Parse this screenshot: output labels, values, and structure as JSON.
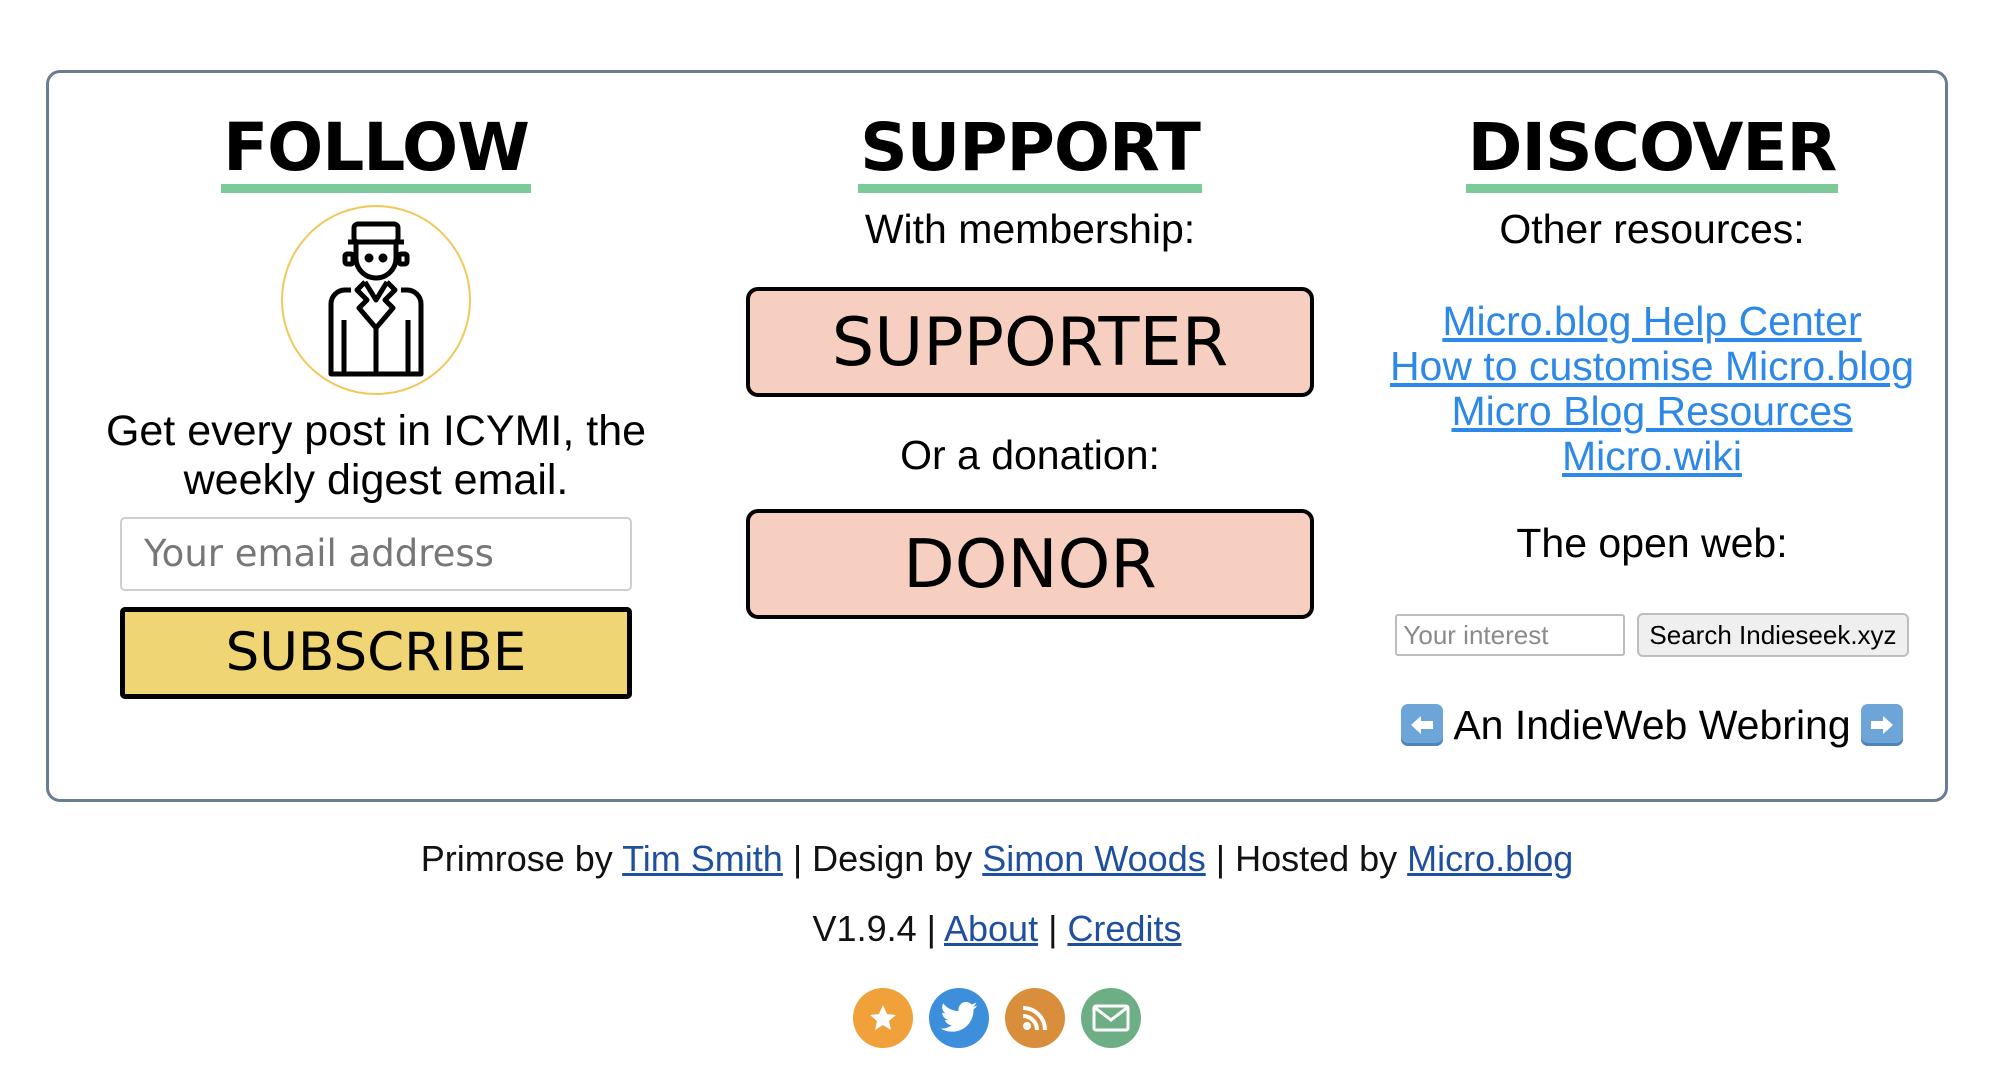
{
  "follow": {
    "heading": "FOLLOW",
    "digest_line1": "Get every post in ICYMI, the",
    "digest_line2": "weekly digest email.",
    "email_placeholder": "Your email address",
    "subscribe_label": "SUBSCRIBE"
  },
  "support": {
    "heading": "SUPPORT",
    "membership_text": "With membership:",
    "supporter_label": "SUPPORTER",
    "donation_text": "Or a donation:",
    "donor_label": "DONOR"
  },
  "discover": {
    "heading": "DISCOVER",
    "resources_text": "Other resources:",
    "links": [
      "Micro.blog Help Center",
      "How to customise Micro.blog",
      "Micro Blog Resources",
      "Micro.wiki"
    ],
    "open_web_text": "The open web:",
    "interest_placeholder": "Your interest",
    "search_button": "Search Indieseek.xyz",
    "webring_text": "An IndieWeb Webring"
  },
  "footer": {
    "primrose_prefix": "Primrose by ",
    "primrose_author": "Tim Smith",
    "design_prefix": " | Design by ",
    "design_author": "Simon Woods",
    "hosted_prefix": " | Hosted by ",
    "host": "Micro.blog",
    "version": "V1.9.4",
    "sep1": " | ",
    "about": "About",
    "sep2": " | ",
    "credits": "Credits"
  },
  "icons": {
    "avatar": "doorman-avatar-icon",
    "left_arrow": "left-arrow-icon",
    "right_arrow": "right-arrow-icon",
    "social": [
      "micro-blog-icon",
      "twitter-icon",
      "rss-icon",
      "email-icon"
    ]
  },
  "colors": {
    "accent_underline": "#7cc99a",
    "subscribe_bg": "#f0d574",
    "support_btn_bg": "#f7cfc0",
    "link": "#2e88e8",
    "footer_link": "#1f4f9f",
    "panel_border": "#6b7d95"
  }
}
